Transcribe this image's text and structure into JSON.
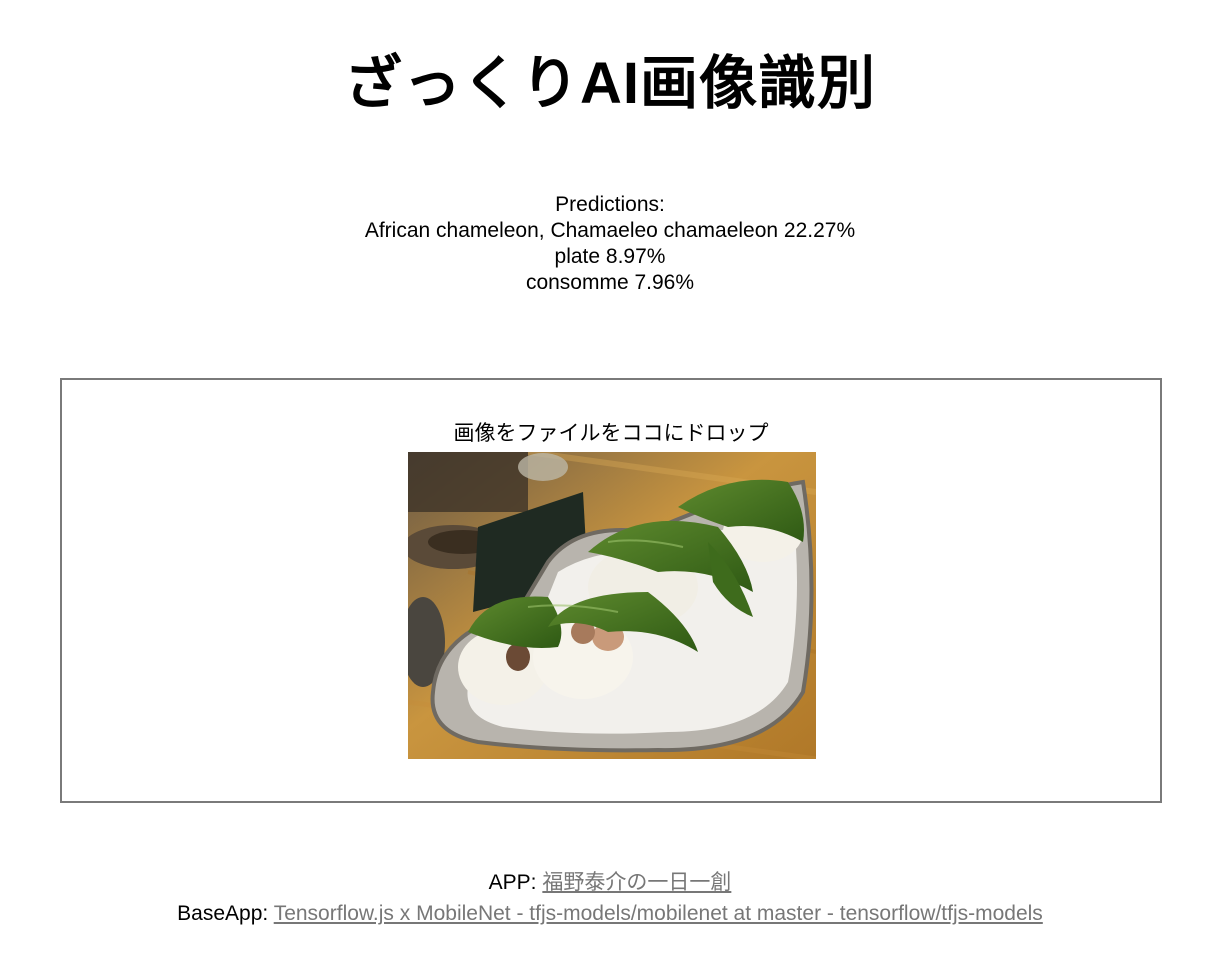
{
  "header": {
    "title": "ざっくりAI画像識別"
  },
  "predictions": {
    "heading": "Predictions:",
    "items": [
      "African chameleon, Chamaeleo chamaeleon 22.27%",
      "plate 8.97%",
      "consomme 7.96%"
    ]
  },
  "dropzone": {
    "label": "画像をファイルをココにドロップ"
  },
  "footer": {
    "app_label": "APP: ",
    "app_link": "福野泰介の一日一創",
    "base_label": "BaseApp: ",
    "base_link": "Tensorflow.js x MobileNet - tfjs-models/mobilenet at master - tensorflow/tfjs-models"
  },
  "colors": {
    "border": "#7a7a7a",
    "link": "#777777",
    "text": "#000000"
  }
}
